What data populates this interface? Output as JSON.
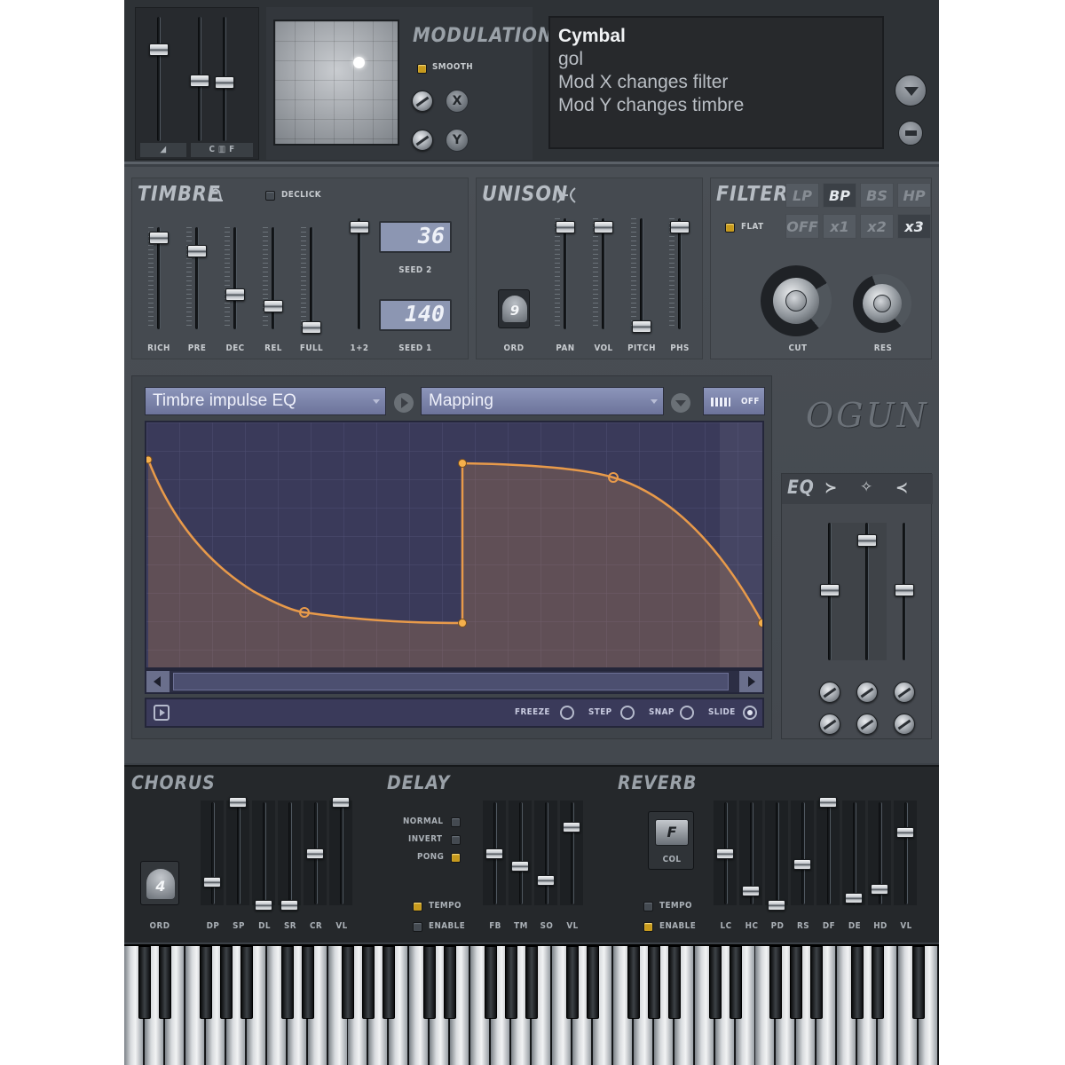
{
  "preset": {
    "name": "Cymbal",
    "author": "gol",
    "line1": "Mod X changes filter",
    "line2": "Mod Y changes timbre"
  },
  "modulation": {
    "title": "MODULATION",
    "smooth_label": "SMOOTH",
    "x_label": "X",
    "y_label": "Y"
  },
  "top_fader_labels": {
    "a": "◢",
    "b": "C ▥ F"
  },
  "timbre": {
    "title": "TIMBRE",
    "declick_label": "DECLICK",
    "fader_labels": [
      "RICH",
      "PRE",
      "DEC",
      "REL",
      "FULL",
      "1+2"
    ],
    "seed1_value": "36",
    "seed1_label": "SEED 2",
    "seed2_value": "140",
    "seed2_label": "SEED 1"
  },
  "unison": {
    "title": "UNISON",
    "order_value": "9",
    "order_label": "ORD",
    "fader_labels": [
      "PAN",
      "VOL",
      "PITCH",
      "PHS"
    ]
  },
  "filter": {
    "title": "FILTER",
    "types": [
      "LP",
      "BP",
      "BS",
      "HP"
    ],
    "active_type": "BP",
    "mults": [
      "OFF",
      "x1",
      "x2",
      "x3"
    ],
    "active_mult": "x3",
    "flat_label": "FLAT",
    "knob_labels": [
      "CUT",
      "RES"
    ]
  },
  "envelope": {
    "target": "Timbre impulse EQ",
    "mode": "Mapping",
    "toggle_label": "OFF",
    "options": [
      "FREEZE",
      "STEP",
      "SNAP",
      "SLIDE"
    ],
    "selected_option": "SLIDE"
  },
  "brand": "OGUN",
  "eq": {
    "title": "EQ"
  },
  "chorus": {
    "title": "CHORUS",
    "order_value": "4",
    "order_label": "ORD",
    "fader_labels": [
      "DP",
      "SP",
      "DL",
      "SR",
      "CR",
      "VL"
    ]
  },
  "delay": {
    "title": "DELAY",
    "modes": [
      "NORMAL",
      "INVERT",
      "PONG"
    ],
    "tempo_label": "TEMPO",
    "enable_label": "ENABLE",
    "fader_labels": [
      "FB",
      "TM",
      "SO",
      "VL"
    ]
  },
  "reverb": {
    "title": "REVERB",
    "col_value": "F",
    "col_label": "COL",
    "tempo_label": "TEMPO",
    "enable_label": "ENABLE",
    "fader_labels": [
      "LC",
      "HC",
      "PD",
      "RS",
      "DF",
      "DE",
      "HD",
      "VL"
    ]
  },
  "colors": {
    "accent": "#e89a4a",
    "led": "#c79a1d",
    "panel": "#3b4046",
    "dark_panel": "#2a2e32",
    "graph_bg": "#3a3a5a"
  }
}
